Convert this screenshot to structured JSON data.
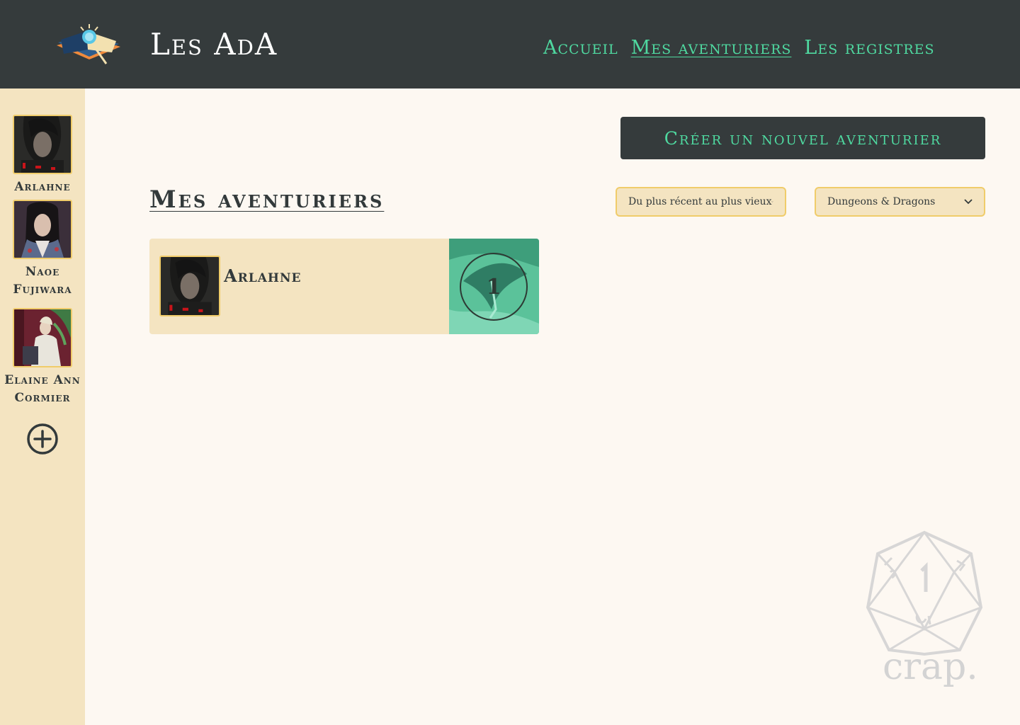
{
  "header": {
    "brand": "Les AdA",
    "nav": [
      {
        "label": "Accueil",
        "active": false
      },
      {
        "label": "Mes aventuriers",
        "active": true
      },
      {
        "label": "Les registres",
        "active": false
      }
    ]
  },
  "sidebar": {
    "characters": [
      {
        "name": "Arlahne",
        "icon": "portrait-dark-hair"
      },
      {
        "name": "Naoe Fujiwara",
        "icon": "portrait-woman"
      },
      {
        "name": "Elaine Ann Cormier",
        "icon": "portrait-seated"
      }
    ],
    "add_icon": "add-circle-icon"
  },
  "main": {
    "create_label": "Créer un nouvel aventurier",
    "title": "Mes aventuriers",
    "sort": {
      "selected": "Du plus récent au plus vieux"
    },
    "game": {
      "selected": "Dungeons & Dragons"
    },
    "cards": [
      {
        "name": "Arlahne",
        "level": "1"
      }
    ]
  },
  "footer_logo": {
    "text": "crap."
  },
  "colors": {
    "header_bg": "#353b3c",
    "accent": "#4fd9a0",
    "sidebar_bg": "#f4e4c1",
    "page_bg": "#fdf8f2",
    "border_gold": "#f0cc6a"
  }
}
